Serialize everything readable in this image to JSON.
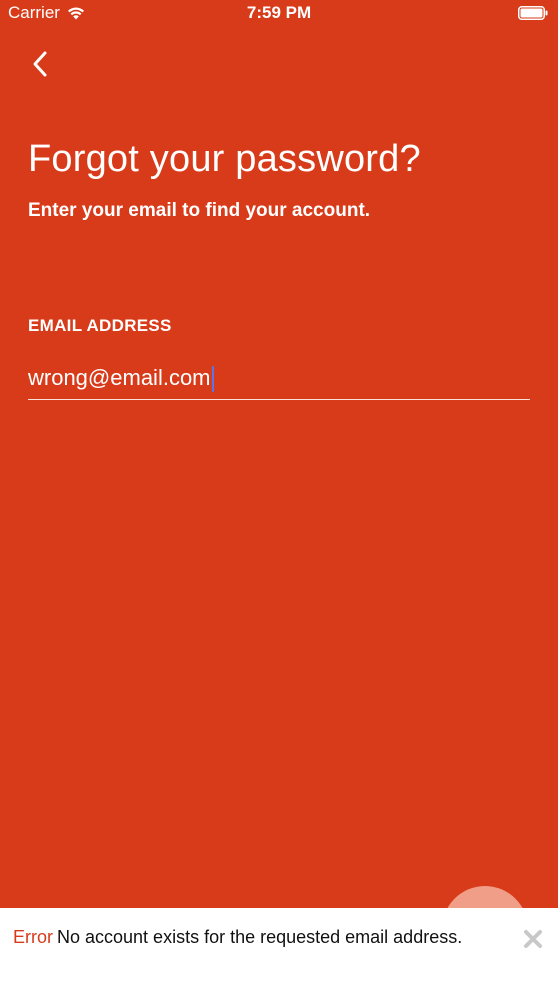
{
  "status_bar": {
    "carrier": "Carrier",
    "time": "7:59 PM"
  },
  "header": {
    "back_icon": "chevron-left-icon"
  },
  "main": {
    "title": "Forgot your password?",
    "subtitle": "Enter your email to find your account.",
    "email_label": "EMAIL ADDRESS",
    "email_value": "wrong@email.com"
  },
  "toast": {
    "tag": "Error",
    "message": "No account exists for the requested email address.",
    "close_icon": "close-icon"
  },
  "colors": {
    "background": "#D83B1A",
    "accent_fab": "#F09E87",
    "error_tag": "#D83B1A",
    "cursor": "#5B74E8"
  }
}
